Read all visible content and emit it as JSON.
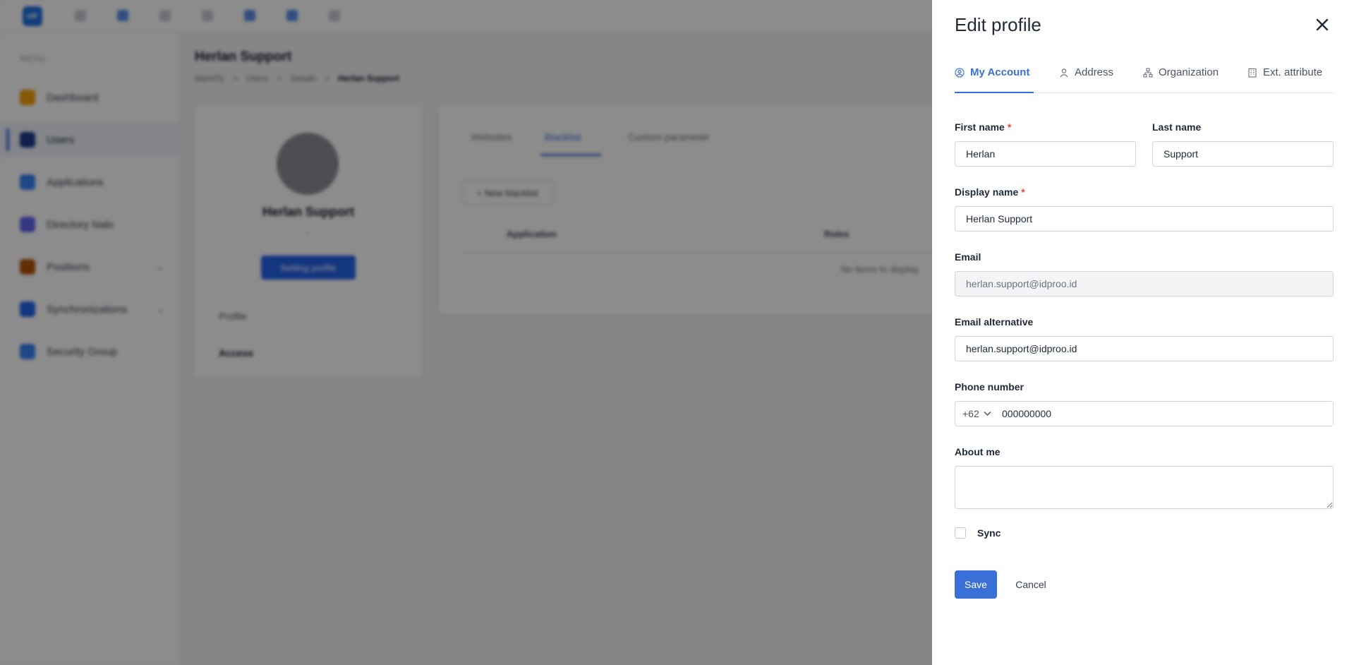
{
  "background": {
    "logo_text": "IdP",
    "sidebar_section": "MENU",
    "sidebar": [
      {
        "label": "Dashboard",
        "color": "#f59e0b"
      },
      {
        "label": "Users",
        "color": "#1e3a8a"
      },
      {
        "label": "Applications",
        "color": "#3b82f6"
      },
      {
        "label": "Directory Nalo",
        "color": "#6366f1"
      },
      {
        "label": "Positions",
        "color": "#b45309"
      },
      {
        "label": "Synchronizations",
        "color": "#2563eb"
      },
      {
        "label": "Security Group",
        "color": "#3b82f6"
      }
    ],
    "page_title": "Herlan Support",
    "breadcrumb": [
      "IdentiTy",
      "Users",
      "Details",
      "Herlan Support"
    ],
    "profile": {
      "name": "Herlan Support",
      "dash": "-",
      "edit_button": "Setting profile",
      "items": [
        "Profile",
        "Access"
      ]
    },
    "tabs": [
      "Websites",
      "Blacklist",
      "Custom parameter"
    ],
    "new_button": "+ New blacklist",
    "table_headers": [
      "Application",
      "Roles"
    ],
    "empty_text": "No items to display"
  },
  "drawer": {
    "title": "Edit profile",
    "tabs": [
      "My Account",
      "Address",
      "Organization",
      "Ext. attribute"
    ],
    "active_tab": "My Account",
    "fields": {
      "first_name_label": "First name",
      "first_name_value": "Herlan",
      "last_name_label": "Last name",
      "last_name_value": "Support",
      "display_name_label": "Display name",
      "display_name_value": "Herlan Support",
      "email_label": "Email",
      "email_value": "herlan.support@idproo.id",
      "email_alt_label": "Email alternative",
      "email_alt_value": "herlan.support@idproo.id",
      "phone_label": "Phone number",
      "phone_code": "+62",
      "phone_value": "000000000",
      "about_label": "About me",
      "about_value": ""
    },
    "required_mark": "*",
    "sync_label": "Sync",
    "sync_checked": false,
    "save_label": "Save",
    "cancel_label": "Cancel",
    "accent_color": "#3b6fd8"
  }
}
